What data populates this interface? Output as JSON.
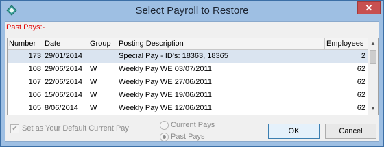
{
  "window": {
    "title": "Select Payroll to Restore",
    "close_label": "✕"
  },
  "section_label": "Past Pays:-",
  "table": {
    "headers": [
      "Number",
      "Date",
      "Group",
      "Posting Description",
      "Employees"
    ],
    "rows": [
      {
        "number": "173",
        "date": "29/01/2014",
        "group": "",
        "description": "Special Pay - ID's: 18363, 18365",
        "employees": "2"
      },
      {
        "number": "108",
        "date": "29/06/2014",
        "group": "W",
        "description": "Weekly Pay WE 03/07/2011",
        "employees": "62"
      },
      {
        "number": "107",
        "date": "22/06/2014",
        "group": "W",
        "description": "Weekly Pay WE 27/06/2011",
        "employees": "62"
      },
      {
        "number": "106",
        "date": "15/06/2014",
        "group": "W",
        "description": "Weekly Pay WE 19/06/2011",
        "employees": "62"
      },
      {
        "number": "105",
        "date": "8/06/2014",
        "group": "W",
        "description": "Weekly Pay WE 12/06/2011",
        "employees": "62"
      }
    ]
  },
  "default_checkbox": {
    "label": "Set as Your Default Current Pay",
    "checked": true
  },
  "radios": [
    {
      "label": "Current Pays",
      "selected": false
    },
    {
      "label": "Past Pays",
      "selected": true
    }
  ],
  "buttons": {
    "ok": "OK",
    "cancel": "Cancel"
  }
}
